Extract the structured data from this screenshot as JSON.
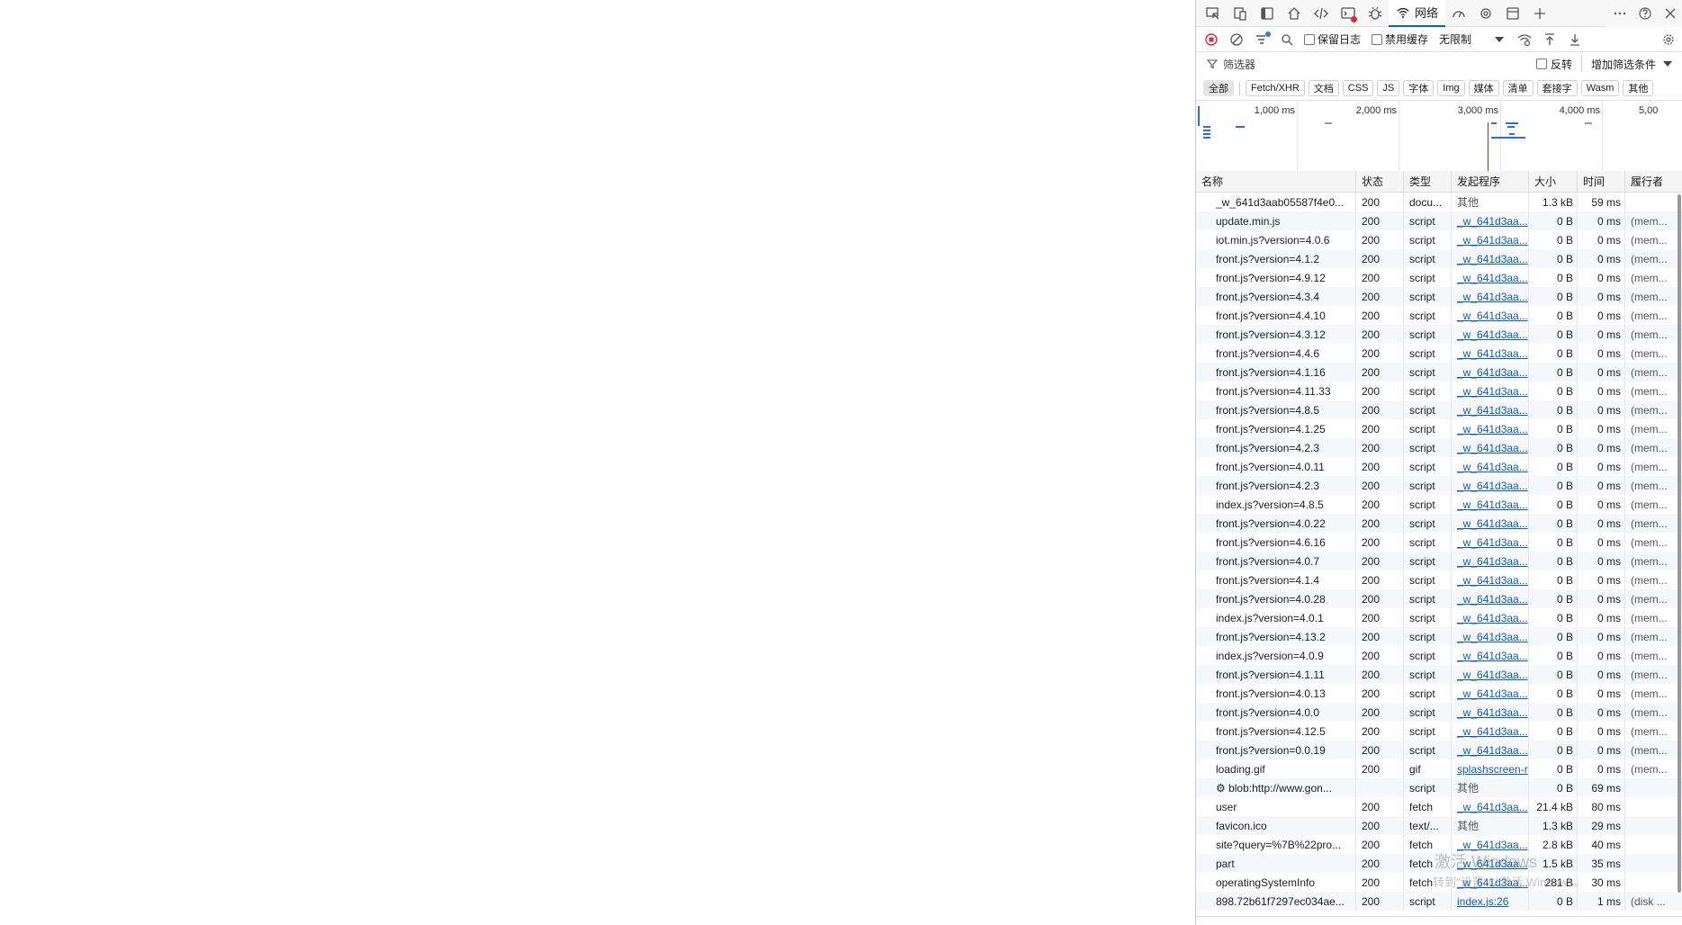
{
  "devtools": {
    "network_tab_label": "网络",
    "toolbar": {
      "preserve_log_label": "保留日志",
      "disable_cache_label": "禁用缓存",
      "throttle_value": "无限制"
    },
    "filter": {
      "placeholder": "筛选器",
      "invert_label": "反转",
      "add_filter_label": "增加筛选条件"
    },
    "type_chips": [
      "全部",
      "Fetch/XHR",
      "文档",
      "CSS",
      "JS",
      "字体",
      "Img",
      "媒体",
      "清单",
      "套接字",
      "Wasm",
      "其他"
    ],
    "overview_ticks": [
      "1,000 ms",
      "2,000 ms",
      "3,000 ms",
      "4,000 ms",
      "5,00"
    ],
    "columns": {
      "name": "名称",
      "status": "状态",
      "type": "类型",
      "initiator": "发起程序",
      "size": "大小",
      "time": "时间",
      "fulfilled_by": "履行者"
    },
    "rows": [
      {
        "name": "_w_641d3aab05587f4e0...",
        "status": "200",
        "type": "docu...",
        "initiator": "其他",
        "initiator_link": false,
        "size": "1.3 kB",
        "time": "59 ms",
        "fulfilled": ""
      },
      {
        "name": "update.min.js",
        "status": "200",
        "type": "script",
        "initiator": "_w_641d3aa...",
        "initiator_link": true,
        "size": "0 B",
        "time": "0 ms",
        "fulfilled": "(mem..."
      },
      {
        "name": "iot.min.js?version=4.0.6",
        "status": "200",
        "type": "script",
        "initiator": "_w_641d3aa...",
        "initiator_link": true,
        "size": "0 B",
        "time": "0 ms",
        "fulfilled": "(mem..."
      },
      {
        "name": "front.js?version=4.1.2",
        "status": "200",
        "type": "script",
        "initiator": "_w_641d3aa...",
        "initiator_link": true,
        "size": "0 B",
        "time": "0 ms",
        "fulfilled": "(mem..."
      },
      {
        "name": "front.js?version=4.9.12",
        "status": "200",
        "type": "script",
        "initiator": "_w_641d3aa...",
        "initiator_link": true,
        "size": "0 B",
        "time": "0 ms",
        "fulfilled": "(mem..."
      },
      {
        "name": "front.js?version=4.3.4",
        "status": "200",
        "type": "script",
        "initiator": "_w_641d3aa...",
        "initiator_link": true,
        "size": "0 B",
        "time": "0 ms",
        "fulfilled": "(mem..."
      },
      {
        "name": "front.js?version=4.4.10",
        "status": "200",
        "type": "script",
        "initiator": "_w_641d3aa...",
        "initiator_link": true,
        "size": "0 B",
        "time": "0 ms",
        "fulfilled": "(mem..."
      },
      {
        "name": "front.js?version=4.3.12",
        "status": "200",
        "type": "script",
        "initiator": "_w_641d3aa...",
        "initiator_link": true,
        "size": "0 B",
        "time": "0 ms",
        "fulfilled": "(mem..."
      },
      {
        "name": "front.js?version=4.4.6",
        "status": "200",
        "type": "script",
        "initiator": "_w_641d3aa...",
        "initiator_link": true,
        "size": "0 B",
        "time": "0 ms",
        "fulfilled": "(mem..."
      },
      {
        "name": "front.js?version=4.1.16",
        "status": "200",
        "type": "script",
        "initiator": "_w_641d3aa...",
        "initiator_link": true,
        "size": "0 B",
        "time": "0 ms",
        "fulfilled": "(mem..."
      },
      {
        "name": "front.js?version=4.11.33",
        "status": "200",
        "type": "script",
        "initiator": "_w_641d3aa...",
        "initiator_link": true,
        "size": "0 B",
        "time": "0 ms",
        "fulfilled": "(mem..."
      },
      {
        "name": "front.js?version=4.8.5",
        "status": "200",
        "type": "script",
        "initiator": "_w_641d3aa...",
        "initiator_link": true,
        "size": "0 B",
        "time": "0 ms",
        "fulfilled": "(mem..."
      },
      {
        "name": "front.js?version=4.1.25",
        "status": "200",
        "type": "script",
        "initiator": "_w_641d3aa...",
        "initiator_link": true,
        "size": "0 B",
        "time": "0 ms",
        "fulfilled": "(mem..."
      },
      {
        "name": "front.js?version=4.2.3",
        "status": "200",
        "type": "script",
        "initiator": "_w_641d3aa...",
        "initiator_link": true,
        "size": "0 B",
        "time": "0 ms",
        "fulfilled": "(mem..."
      },
      {
        "name": "front.js?version=4.0.11",
        "status": "200",
        "type": "script",
        "initiator": "_w_641d3aa...",
        "initiator_link": true,
        "size": "0 B",
        "time": "0 ms",
        "fulfilled": "(mem..."
      },
      {
        "name": "front.js?version=4.2.3",
        "status": "200",
        "type": "script",
        "initiator": "_w_641d3aa...",
        "initiator_link": true,
        "size": "0 B",
        "time": "0 ms",
        "fulfilled": "(mem..."
      },
      {
        "name": "index.js?version=4.8.5",
        "status": "200",
        "type": "script",
        "initiator": "_w_641d3aa...",
        "initiator_link": true,
        "size": "0 B",
        "time": "0 ms",
        "fulfilled": "(mem..."
      },
      {
        "name": "front.js?version=4.0.22",
        "status": "200",
        "type": "script",
        "initiator": "_w_641d3aa...",
        "initiator_link": true,
        "size": "0 B",
        "time": "0 ms",
        "fulfilled": "(mem..."
      },
      {
        "name": "front.js?version=4.6.16",
        "status": "200",
        "type": "script",
        "initiator": "_w_641d3aa...",
        "initiator_link": true,
        "size": "0 B",
        "time": "0 ms",
        "fulfilled": "(mem..."
      },
      {
        "name": "front.js?version=4.0.7",
        "status": "200",
        "type": "script",
        "initiator": "_w_641d3aa...",
        "initiator_link": true,
        "size": "0 B",
        "time": "0 ms",
        "fulfilled": "(mem..."
      },
      {
        "name": "front.js?version=4.1.4",
        "status": "200",
        "type": "script",
        "initiator": "_w_641d3aa...",
        "initiator_link": true,
        "size": "0 B",
        "time": "0 ms",
        "fulfilled": "(mem..."
      },
      {
        "name": "front.js?version=4.0.28",
        "status": "200",
        "type": "script",
        "initiator": "_w_641d3aa...",
        "initiator_link": true,
        "size": "0 B",
        "time": "0 ms",
        "fulfilled": "(mem..."
      },
      {
        "name": "index.js?version=4.0.1",
        "status": "200",
        "type": "script",
        "initiator": "_w_641d3aa...",
        "initiator_link": true,
        "size": "0 B",
        "time": "0 ms",
        "fulfilled": "(mem..."
      },
      {
        "name": "front.js?version=4.13.2",
        "status": "200",
        "type": "script",
        "initiator": "_w_641d3aa...",
        "initiator_link": true,
        "size": "0 B",
        "time": "0 ms",
        "fulfilled": "(mem..."
      },
      {
        "name": "index.js?version=4.0.9",
        "status": "200",
        "type": "script",
        "initiator": "_w_641d3aa...",
        "initiator_link": true,
        "size": "0 B",
        "time": "0 ms",
        "fulfilled": "(mem..."
      },
      {
        "name": "front.js?version=4.1.11",
        "status": "200",
        "type": "script",
        "initiator": "_w_641d3aa...",
        "initiator_link": true,
        "size": "0 B",
        "time": "0 ms",
        "fulfilled": "(mem..."
      },
      {
        "name": "front.js?version=4.0.13",
        "status": "200",
        "type": "script",
        "initiator": "_w_641d3aa...",
        "initiator_link": true,
        "size": "0 B",
        "time": "0 ms",
        "fulfilled": "(mem..."
      },
      {
        "name": "front.js?version=4.0.0",
        "status": "200",
        "type": "script",
        "initiator": "_w_641d3aa...",
        "initiator_link": true,
        "size": "0 B",
        "time": "0 ms",
        "fulfilled": "(mem..."
      },
      {
        "name": "front.js?version=4.12.5",
        "status": "200",
        "type": "script",
        "initiator": "_w_641d3aa...",
        "initiator_link": true,
        "size": "0 B",
        "time": "0 ms",
        "fulfilled": "(mem..."
      },
      {
        "name": "front.js?version=0.0.19",
        "status": "200",
        "type": "script",
        "initiator": "_w_641d3aa...",
        "initiator_link": true,
        "size": "0 B",
        "time": "0 ms",
        "fulfilled": "(mem..."
      },
      {
        "name": "loading.gif",
        "status": "200",
        "type": "gif",
        "initiator": "splashscreen-r",
        "initiator_link": true,
        "size": "0 B",
        "time": "0 ms",
        "fulfilled": "(mem..."
      },
      {
        "name": "⚙ blob:http://www.gon...",
        "status": "",
        "type": "script",
        "initiator": "其他",
        "initiator_link": false,
        "size": "0 B",
        "time": "69 ms",
        "fulfilled": ""
      },
      {
        "name": "user",
        "status": "200",
        "type": "fetch",
        "initiator": "_w_641d3aa...",
        "initiator_link": true,
        "size": "21.4 kB",
        "time": "80 ms",
        "fulfilled": ""
      },
      {
        "name": "favicon.ico",
        "status": "200",
        "type": "text/...",
        "initiator": "其他",
        "initiator_link": false,
        "size": "1.3 kB",
        "time": "29 ms",
        "fulfilled": ""
      },
      {
        "name": "site?query=%7B%22pro...",
        "status": "200",
        "type": "fetch",
        "initiator": "_w_641d3aa...",
        "initiator_link": true,
        "size": "2.8 kB",
        "time": "40 ms",
        "fulfilled": ""
      },
      {
        "name": "part",
        "status": "200",
        "type": "fetch",
        "initiator": "_w_641d3aa...",
        "initiator_link": true,
        "size": "1.5 kB",
        "time": "35 ms",
        "fulfilled": ""
      },
      {
        "name": "operatingSystemInfo",
        "status": "200",
        "type": "fetch",
        "initiator": "_w_641d3aa...",
        "initiator_link": true,
        "size": "281 B",
        "time": "30 ms",
        "fulfilled": ""
      },
      {
        "name": "898.72b61f7297ec034ae...",
        "status": "200",
        "type": "script",
        "initiator": "index.js:26",
        "initiator_link": true,
        "size": "0 B",
        "time": "1 ms",
        "fulfilled": "(disk ..."
      }
    ]
  },
  "watermark": {
    "line1": "激活 Windows",
    "line2": "转到\"设置\"以激活 Windows。"
  },
  "colors": {
    "accent": "#0067c0",
    "link": "#0a5cc5",
    "record_red": "#e0283a"
  }
}
